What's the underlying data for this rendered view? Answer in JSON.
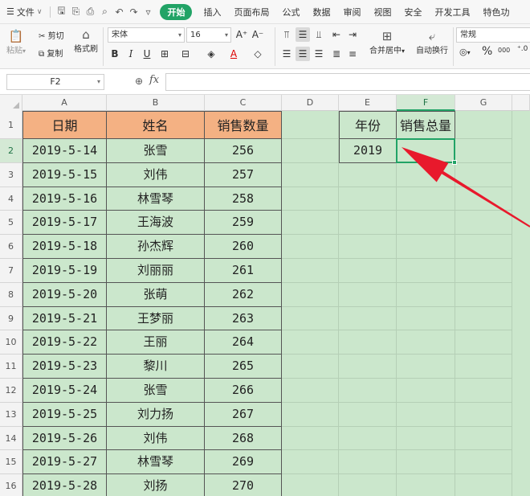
{
  "menubar": {
    "file_label": "文件",
    "tabs": [
      "开始",
      "插入",
      "页面布局",
      "公式",
      "数据",
      "审阅",
      "视图",
      "安全",
      "开发工具",
      "特色功"
    ],
    "active_tab": "开始"
  },
  "ribbon": {
    "paste_label": "粘贴",
    "cut_label": "剪切",
    "copy_label": "复制",
    "format_painter_label": "格式刷",
    "font_name": "宋体",
    "font_size": "16",
    "grow_font": "A⁺",
    "shrink_font": "A⁻",
    "bold": "B",
    "italic": "I",
    "underline": "U",
    "merge_label": "合并居中",
    "wrap_label": "自动换行",
    "number_format": "常规",
    "percent": "%",
    "thousands": "000"
  },
  "formula_bar": {
    "name_box": "F2",
    "fx_label": "fx",
    "formula": ""
  },
  "sheet": {
    "columns": [
      "A",
      "B",
      "C",
      "D",
      "E",
      "F",
      "G"
    ],
    "selected_column": "F",
    "selected_row": "2",
    "rows": [
      "1",
      "2",
      "3",
      "4",
      "5",
      "6",
      "7",
      "8",
      "9",
      "10",
      "11",
      "12",
      "13",
      "14",
      "15",
      "16"
    ],
    "table": {
      "headers": [
        "日期",
        "姓名",
        "销售数量"
      ],
      "records": [
        [
          "2019-5-14",
          "张雪",
          "256"
        ],
        [
          "2019-5-15",
          "刘伟",
          "257"
        ],
        [
          "2019-5-16",
          "林雪琴",
          "258"
        ],
        [
          "2019-5-17",
          "王海波",
          "259"
        ],
        [
          "2019-5-18",
          "孙杰辉",
          "260"
        ],
        [
          "2019-5-19",
          "刘丽丽",
          "261"
        ],
        [
          "2019-5-20",
          "张萌",
          "262"
        ],
        [
          "2019-5-21",
          "王梦丽",
          "263"
        ],
        [
          "2019-5-22",
          "王丽",
          "264"
        ],
        [
          "2019-5-23",
          "黎川",
          "265"
        ],
        [
          "2019-5-24",
          "张雪",
          "266"
        ],
        [
          "2019-5-25",
          "刘力扬",
          "267"
        ],
        [
          "2019-5-26",
          "刘伟",
          "268"
        ],
        [
          "2019-5-27",
          "林雪琴",
          "269"
        ],
        [
          "2019-5-28",
          "刘扬",
          "270"
        ]
      ]
    },
    "side_table": {
      "year_header": "年份",
      "total_header": "销售总量",
      "year_value": "2019",
      "total_value": ""
    }
  },
  "colors": {
    "accent": "#21a366",
    "header_fill": "#f4b183",
    "sheet_fill": "#cbe7cc",
    "arrow": "#e8192c"
  }
}
